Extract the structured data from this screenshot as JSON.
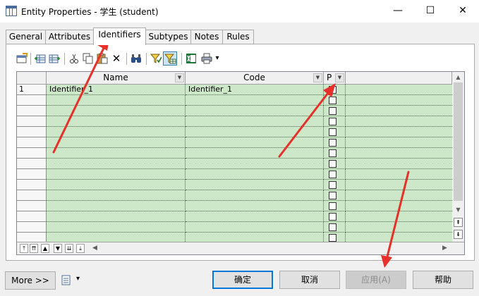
{
  "window": {
    "title": "Entity Properties - 学生 (student)",
    "minimize_glyph": "—",
    "maximize_glyph": "☐",
    "close_glyph": "✕"
  },
  "tabs": [
    {
      "label": "General",
      "active": false
    },
    {
      "label": "Attributes",
      "active": false
    },
    {
      "label": "Identifiers",
      "active": true
    },
    {
      "label": "Subtypes",
      "active": false
    },
    {
      "label": "Notes",
      "active": false
    },
    {
      "label": "Rules",
      "active": false
    }
  ],
  "toolbar": {
    "icons": [
      "properties-icon",
      "add-row-icon",
      "insert-row-icon",
      "cut-icon",
      "copy-icon",
      "paste-icon",
      "delete-icon",
      "find-icon",
      "filter-icon",
      "customize-columns-icon",
      "excel-export-icon",
      "print-icon",
      "dropdown-arrow-icon"
    ],
    "delete_glyph": "✕",
    "dropdown_glyph": "▾"
  },
  "grid": {
    "columns": [
      {
        "label": "Name"
      },
      {
        "label": "Code"
      },
      {
        "label": "P"
      }
    ],
    "dropdown_glyph": "▼",
    "rows": [
      {
        "num": "1",
        "name": "Identifier_1",
        "code": "Identifier_1",
        "primary": true
      }
    ],
    "check_glyph": "✓",
    "empty_row_count": 14
  },
  "nav_buttons": [
    "⤒",
    "⇈",
    "▲",
    "▼",
    "⇊",
    "⤓"
  ],
  "scroll_glyphs": {
    "up": "▲",
    "down": "▼",
    "left": "◀",
    "right": "▶",
    "page_up": "⇞",
    "page_down": "⇟"
  },
  "buttons": {
    "more": "More >>",
    "ok": "确定",
    "cancel": "取消",
    "apply": "应用(A)",
    "help": "帮助",
    "dropdown_glyph": "▾"
  },
  "annotation_color": "#e8302a"
}
